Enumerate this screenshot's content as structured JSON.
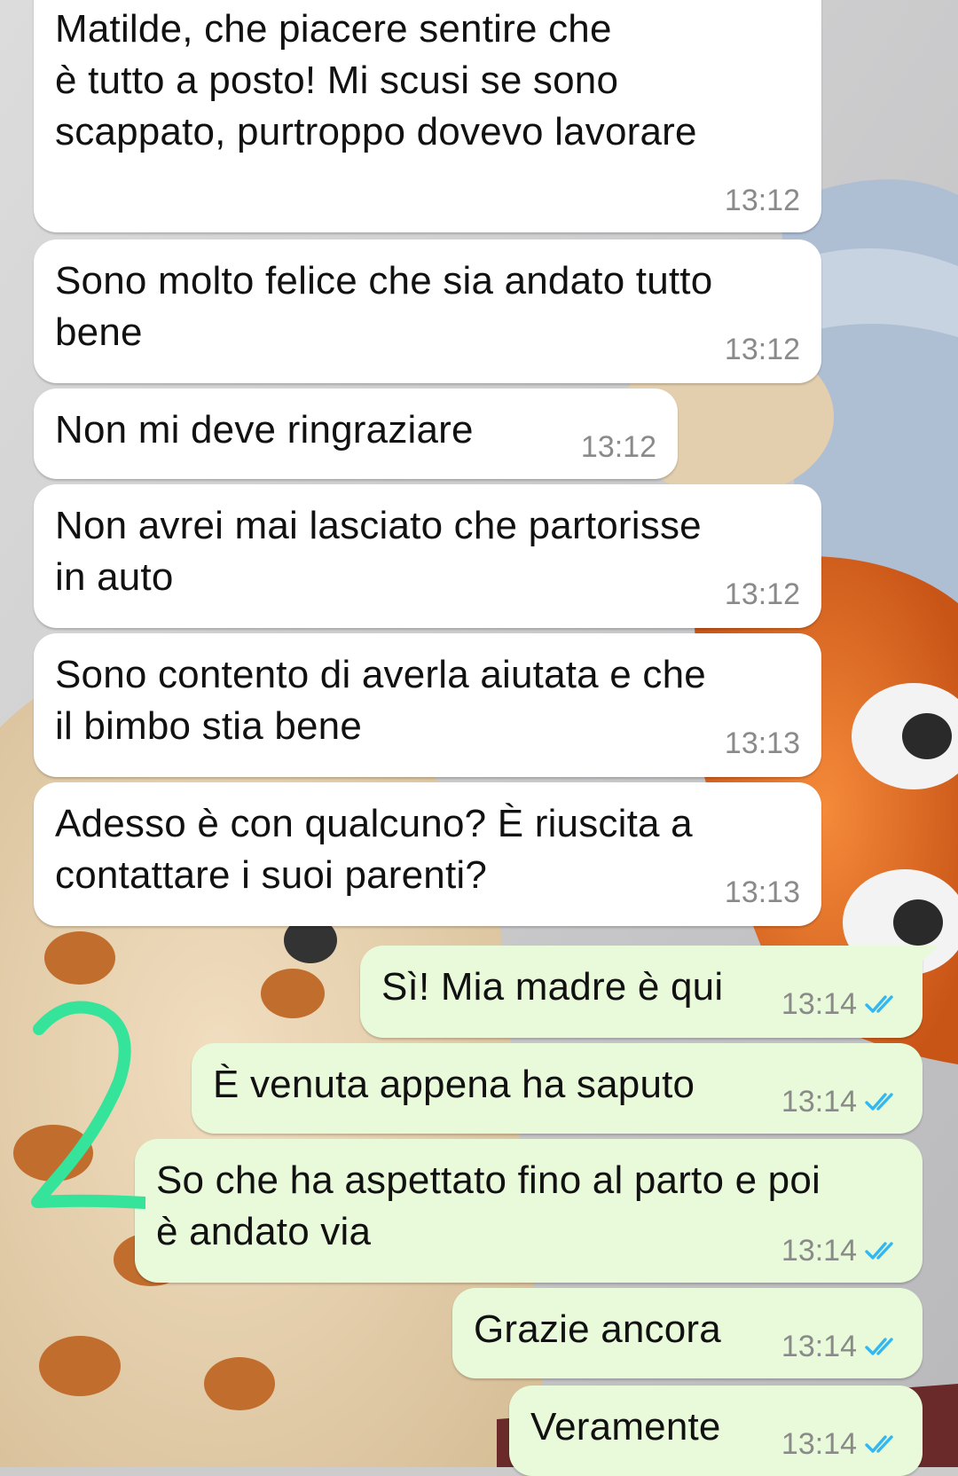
{
  "conversation": {
    "incoming": [
      {
        "lines": [
          "Matilde, che piacere sentire che",
          "è tutto a posto! Mi scusi se sono",
          "scappato, purtroppo dovevo lavorare"
        ],
        "time": "13:12"
      },
      {
        "lines": [
          "Sono molto felice che sia andato tutto",
          "bene"
        ],
        "time": "13:12"
      },
      {
        "lines": [
          "Non mi deve ringraziare"
        ],
        "time": "13:12"
      },
      {
        "lines": [
          "Non avrei mai lasciato che partorisse",
          "in auto"
        ],
        "time": "13:12"
      },
      {
        "lines": [
          "Sono contento di averla aiutata e che",
          "il bimbo stia bene"
        ],
        "time": "13:13"
      },
      {
        "lines": [
          "Adesso è con qualcuno? È riuscita a",
          "contattare i suoi parenti?"
        ],
        "time": "13:13"
      }
    ],
    "outgoing": [
      {
        "lines": [
          "Sì! Mia madre è qui"
        ],
        "time": "13:14",
        "status": "read"
      },
      {
        "lines": [
          "È venuta appena ha saputo"
        ],
        "time": "13:14",
        "status": "read"
      },
      {
        "lines": [
          "So che ha aspettato fino al parto e poi",
          "è andato via"
        ],
        "time": "13:14",
        "status": "read"
      },
      {
        "lines": [
          "Grazie ancora"
        ],
        "time": "13:14",
        "status": "read"
      },
      {
        "lines": [
          "Veramente"
        ],
        "time": "13:14",
        "status": "read"
      }
    ]
  },
  "annotation": {
    "text": "2",
    "color": "#36e39a"
  },
  "colors": {
    "incoming_bubble": "#ffffff",
    "outgoing_bubble": "#e8fad9",
    "time_text": "#8a8a8a",
    "read_check": "#34b7f1"
  },
  "icons": {
    "read_receipt": "double-check-icon"
  }
}
